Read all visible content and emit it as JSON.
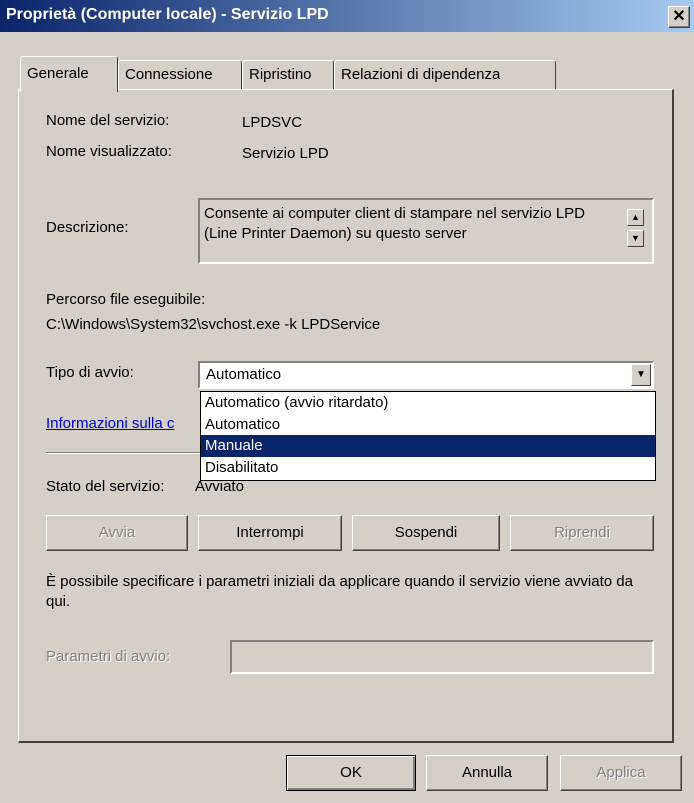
{
  "window": {
    "title": "Proprietà (Computer locale) - Servizio LPD",
    "close_glyph": "✕"
  },
  "tabs": [
    {
      "label": "Generale"
    },
    {
      "label": "Connessione"
    },
    {
      "label": "Ripristino"
    },
    {
      "label": "Relazioni di dipendenza"
    }
  ],
  "general": {
    "service_name_label": "Nome del servizio:",
    "service_name_value": "LPDSVC",
    "display_name_label": "Nome visualizzato:",
    "display_name_value": "Servizio LPD",
    "description_label": "Descrizione:",
    "description_value": "Consente ai computer client di stampare nel servizio LPD (Line Printer Daemon) su questo server",
    "exe_path_label": "Percorso file eseguibile:",
    "exe_path_value": "C:\\Windows\\System32\\svchost.exe -k LPDService",
    "startup_type_label": "Tipo di avvio:",
    "startup_type_value": "Automatico",
    "startup_options": [
      "Automatico (avvio ritardato)",
      "Automatico",
      "Manuale",
      "Disabilitato"
    ],
    "startup_options_highlighted_index": 2,
    "info_link": "Informazioni sulla c",
    "status_label": "Stato del servizio:",
    "status_value": "Avviato",
    "buttons": {
      "start": "Avvia",
      "stop": "Interrompi",
      "pause": "Sospendi",
      "resume": "Riprendi"
    },
    "params_hint": "È possibile specificare i parametri iniziali da applicare quando il servizio viene avviato da qui.",
    "params_label": "Parametri di avvio:",
    "params_value": ""
  },
  "footer": {
    "ok": "OK",
    "cancel": "Annulla",
    "apply": "Applica"
  },
  "colors": {
    "titlebar_start": "#0a246a",
    "titlebar_end": "#a6caf0",
    "face": "#d4d0c8",
    "highlight": "#0a246a",
    "link": "#0000cc"
  }
}
